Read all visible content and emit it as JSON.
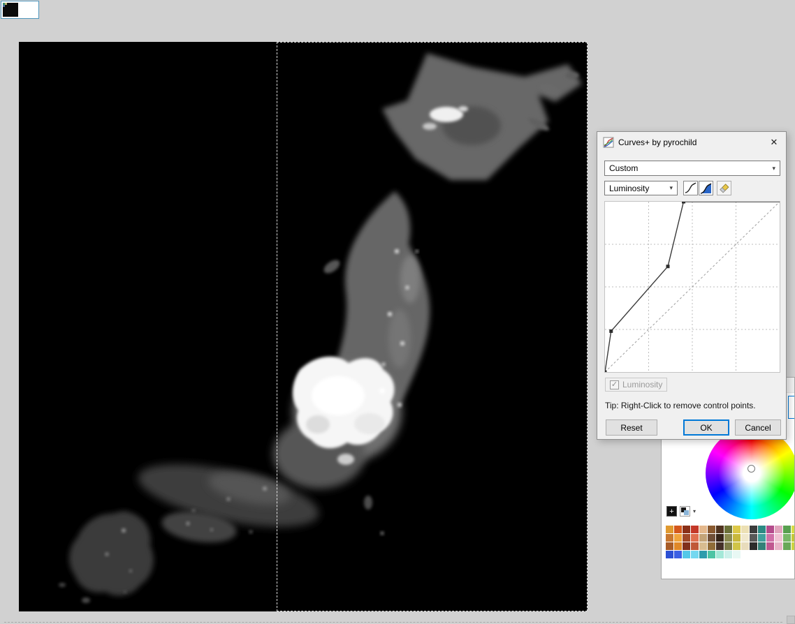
{
  "app": {
    "background": "#d1d1d1",
    "accent_blue": "#0078d7"
  },
  "icons": {
    "close": "✕",
    "chevron": "▾",
    "check": "✓",
    "plus": "+"
  },
  "dialog": {
    "title": "Curves+ by pyrochild",
    "preset": {
      "value": "Custom"
    },
    "channel": {
      "value": "Luminosity"
    },
    "toolbar_icons": [
      "curve-line-icon",
      "curve-filled-icon",
      "eraser-icon"
    ],
    "graph": {
      "points": [
        [
          0,
          0
        ],
        [
          0.035,
          0.24
        ],
        [
          0.36,
          0.62
        ],
        [
          0.45,
          1.0
        ],
        [
          1,
          1
        ]
      ],
      "grid": "4x4 dashed",
      "reference": "diagonal dashed identity line"
    },
    "checkbox": {
      "label": "Luminosity",
      "checked": true,
      "disabled": true
    },
    "tip": "Tip: Right-Click to remove control points.",
    "buttons": {
      "reset": "Reset",
      "ok": "OK",
      "cancel": "Cancel"
    }
  },
  "colors": {
    "palette": [
      [
        "#e09a30",
        "#d4581c",
        "#8a3018",
        "#c43828",
        "#e4b88c",
        "#8a5a30",
        "#503420",
        "#6a7038",
        "#dcc848",
        "#ece0b4",
        "#3c3c3c",
        "#2c8a84",
        "#b44c8c",
        "#e0a4bc",
        "#58a050",
        "#d8dc44"
      ],
      [
        "#c87830",
        "#f0a43c",
        "#a04828",
        "#e07050",
        "#c4a478",
        "#705038",
        "#342418",
        "#8a8a50",
        "#c8b83c",
        "#f0e8cc",
        "#585858",
        "#40a09c",
        "#d070a8",
        "#f0c4d4",
        "#78b868",
        "#c4c838"
      ],
      [
        "#a85c28",
        "#e08828",
        "#80301c",
        "#c05838",
        "#d8bc90",
        "#906c38",
        "#443028",
        "#7c7c48",
        "#d0c448",
        "#e8dcbc",
        "#2c2c2c",
        "#348078",
        "#c05890",
        "#e8b4c8",
        "#68a858",
        "#ccd440"
      ],
      [
        "#2c50d4",
        "#3c60e4",
        "#54c8e8",
        "#74d8f0",
        "#2c9cac",
        "#4cc4a4",
        "#a4e8d8",
        "#ccf0ea",
        "#e8f8f4",
        "#ffffff",
        "#ffffff",
        "#ffffff",
        "#ffffff",
        "#ffffff",
        "#ffffff",
        "#ffffff"
      ]
    ]
  }
}
